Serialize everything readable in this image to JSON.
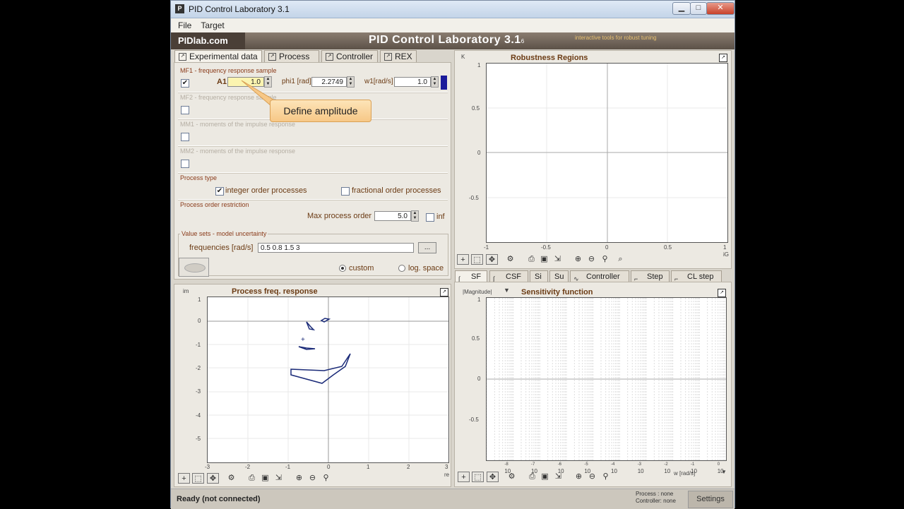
{
  "window": {
    "title": "PID Control Laboratory 3.1",
    "icon": "P"
  },
  "title_buttons": {
    "minimize": "▁",
    "maximize": "□",
    "close": "✕"
  },
  "menu": [
    "File",
    "Target"
  ],
  "banner": {
    "logo": "PIDlab.com",
    "title": "PID Control Laboratory 3.1",
    "version": "6",
    "tagline": "interactive tools for robust tuning"
  },
  "tabs": [
    "Experimental data",
    "Process",
    "Controller",
    "REX"
  ],
  "mf1": {
    "label": "MF1 - frequency response sample",
    "checked": "✔",
    "a_label": "A1",
    "a_value": "1.0",
    "phi_label": "phi1 [rad]",
    "phi_value": "2.2749",
    "w_label": "w1[rad/s]",
    "w_value": "1.0"
  },
  "mf2": {
    "label": "MF2 - frequency response sample"
  },
  "mm1": {
    "label": "MM1 - moments of the impulse response"
  },
  "mm2": {
    "label": "MM2 - moments of the impulse response"
  },
  "process_type": {
    "label": "Process type",
    "integer_label": "integer order processes",
    "integer_checked": "✔",
    "fractional_label": "fractional order processes"
  },
  "order": {
    "label": "Process order restriction",
    "max_label": "Max process order",
    "max_value": "5.0",
    "inf_label": "inf"
  },
  "value_sets": {
    "label": "Value sets - model uncertainty",
    "freq_label": "frequencies [rad/s]",
    "freq_value": "0.5 0.8 1.5 3",
    "browse": "...",
    "custom_label": "custom",
    "log_label": "log. space"
  },
  "callout": "Define amplitude",
  "process_plot": {
    "title": "Process freq. response",
    "yaxis": "im",
    "xaxis": "re",
    "yticks": [
      "1",
      "0",
      "-1",
      "-2",
      "-3",
      "-4",
      "-5"
    ],
    "xticks": [
      "-3",
      "-2",
      "-1",
      "0",
      "1",
      "2",
      "3"
    ]
  },
  "robust_plot": {
    "title": "Robustness Regions",
    "yaxis": "K",
    "xaxis": "iG",
    "yticks": [
      "1",
      "0.5",
      "0",
      "-0.5"
    ],
    "xticks": [
      "-1",
      "-0.5",
      "0",
      "0.5",
      "1"
    ]
  },
  "bottom_tabs": [
    "SF",
    "CSF",
    "Si",
    "Su",
    "Controller",
    "Step",
    "CL step"
  ],
  "sens_plot": {
    "title": "Sensitivity function",
    "mode": "|Magnitude|",
    "yticks": [
      "1",
      "0.5",
      "0",
      "-0.5"
    ],
    "xticks": [
      "-8",
      "-7",
      "-6",
      "-5",
      "-4",
      "-3",
      "-2",
      "-1",
      "0"
    ],
    "xbase": "10",
    "xaxis": "w [rad/s]"
  },
  "toolbar_icons": [
    "add-point-icon",
    "zoom-box-icon",
    "pan-icon",
    "gear-icon",
    "print-icon",
    "save-icon",
    "export-icon",
    "zoom-in-icon",
    "zoom-out-icon",
    "binoculars-icon",
    "zoom-fit-icon"
  ],
  "status": {
    "ready": "Ready (not connected)",
    "process": "Process  : none",
    "controller": "Controller: none",
    "settings": "Settings"
  },
  "colors": {
    "curve": "#1a2a78",
    "accent": "#8a3b1a",
    "blue_block": "#1a1a9a"
  }
}
